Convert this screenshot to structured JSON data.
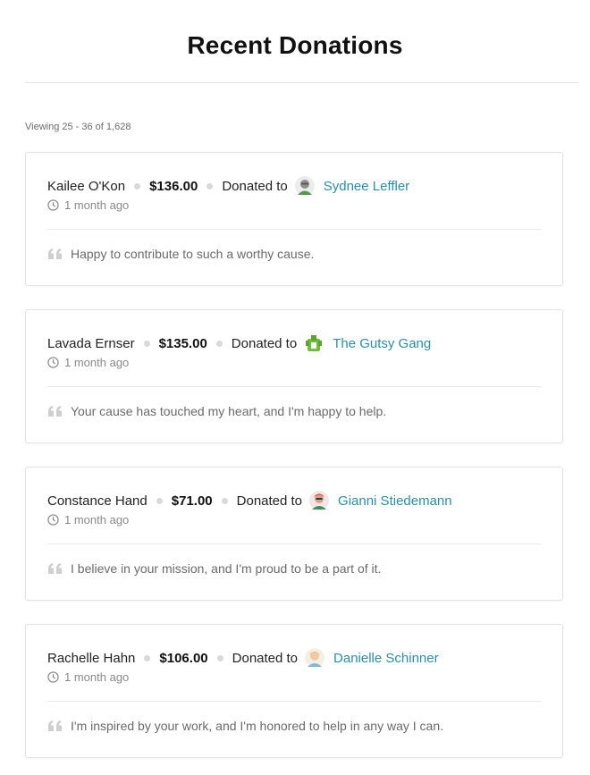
{
  "page": {
    "title": "Recent Donations",
    "viewing_text": "Viewing 25 - 36 of 1,628"
  },
  "colors": {
    "link": "#2a8fa3",
    "separator_dot": "#d9d9d9",
    "muted_text": "#8a8a8a"
  },
  "donations": [
    {
      "donor": "Kailee O'Kon",
      "amount": "$136.00",
      "donated_to_label": "Donated to",
      "recipient": "Sydnee Leffler",
      "recipient_avatar": "person-avatar-grey",
      "time_icon": "clock-icon",
      "time": "1 month ago",
      "quote_icon": "quote-icon",
      "message": "Happy to contribute to such a worthy cause."
    },
    {
      "donor": "Lavada Ernser",
      "amount": "$135.00",
      "donated_to_label": "Donated to",
      "recipient": "The Gutsy Gang",
      "recipient_avatar": "team-avatar-green",
      "time_icon": "clock-icon",
      "time": "1 month ago",
      "quote_icon": "quote-icon",
      "message": "Your cause has touched my heart, and I'm happy to help."
    },
    {
      "donor": "Constance Hand",
      "amount": "$71.00",
      "donated_to_label": "Donated to",
      "recipient": "Gianni Stiedemann",
      "recipient_avatar": "person-avatar-red",
      "time_icon": "clock-icon",
      "time": "1 month ago",
      "quote_icon": "quote-icon",
      "message": "I believe in your mission, and I'm proud to be a part of it."
    },
    {
      "donor": "Rachelle Hahn",
      "amount": "$106.00",
      "donated_to_label": "Donated to",
      "recipient": "Danielle Schinner",
      "recipient_avatar": "person-avatar-yellow",
      "time_icon": "clock-icon",
      "time": "1 month ago",
      "quote_icon": "quote-icon",
      "message": "I'm inspired by your work, and I'm honored to help in any way I can."
    }
  ]
}
